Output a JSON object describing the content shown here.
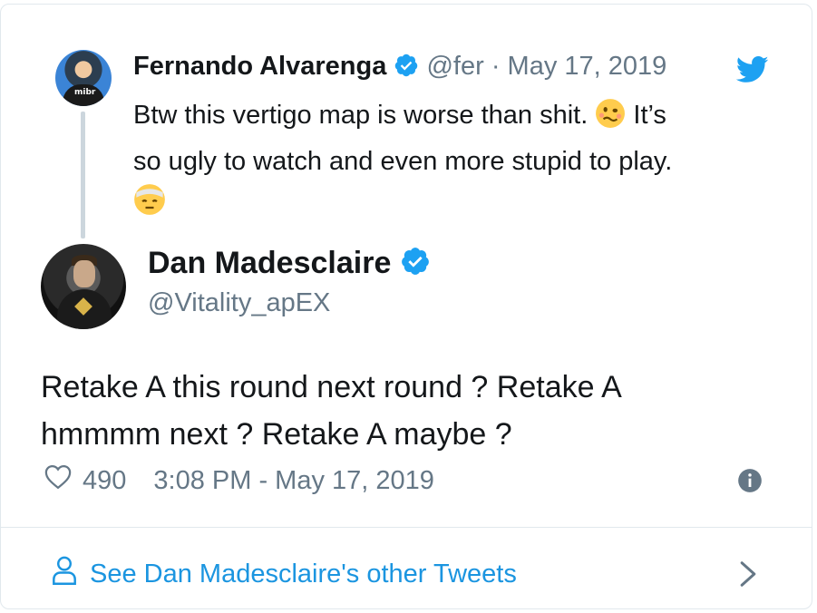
{
  "parent_tweet": {
    "author_name": "Fernando Alvarenga",
    "handle": "@fer",
    "separator": "·",
    "date": "May 17, 2019",
    "text_line1": "Btw this vertigo map is worse than shit.",
    "text_line1_after_emoji": "It’s",
    "text_line2": "so ugly to watch and even more stupid to play.",
    "avatar_text": "mibr"
  },
  "main_tweet": {
    "author_name": "Dan Madesclaire",
    "handle": "@Vitality_apEX",
    "text": "Retake A this round next round ? Retake A hmmmm next ? Retake A maybe ?",
    "like_count": "490",
    "timestamp": "3:08 PM - May 17, 2019"
  },
  "footer": {
    "link_label": "See Dan Madesclaire's other Tweets"
  },
  "colors": {
    "twitter_blue": "#1da1f2",
    "link_blue": "#1b95e0",
    "muted": "#657786",
    "border": "#e1e8ed"
  },
  "icons": [
    "verified-badge-icon",
    "twitter-bird-icon",
    "woozy-face-emoji",
    "bandaged-face-emoji",
    "heart-icon",
    "info-icon",
    "person-icon",
    "chevron-right-icon"
  ]
}
